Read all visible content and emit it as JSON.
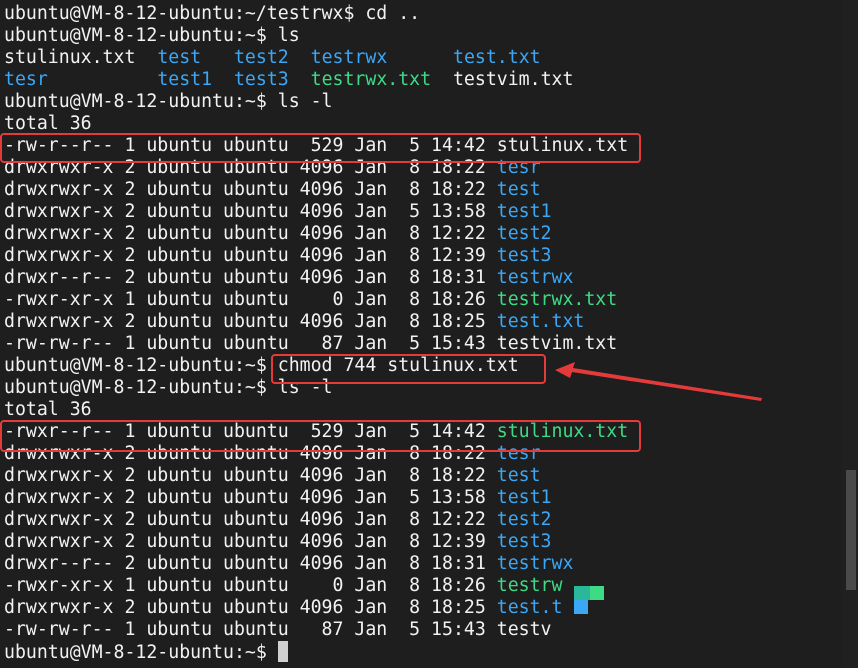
{
  "terminal": {
    "lines": [
      [
        {
          "t": "ubuntu@VM-8-12-ubuntu:~/testrwx$ cd ..",
          "c": "white"
        }
      ],
      [
        {
          "t": "ubuntu@VM-8-12-ubuntu:~$ ls",
          "c": "white"
        }
      ],
      [
        {
          "t": "stulinux.txt  ",
          "c": "white"
        },
        {
          "t": "test",
          "c": "blue"
        },
        {
          "t": "   ",
          "c": "white"
        },
        {
          "t": "test2",
          "c": "blue"
        },
        {
          "t": "  ",
          "c": "white"
        },
        {
          "t": "testrwx",
          "c": "blue"
        },
        {
          "t": "      ",
          "c": "white"
        },
        {
          "t": "test.txt",
          "c": "blue"
        }
      ],
      [
        {
          "t": "tesr",
          "c": "blue"
        },
        {
          "t": "          ",
          "c": "white"
        },
        {
          "t": "test1",
          "c": "blue"
        },
        {
          "t": "  ",
          "c": "white"
        },
        {
          "t": "test3",
          "c": "blue"
        },
        {
          "t": "  ",
          "c": "white"
        },
        {
          "t": "testrwx.txt",
          "c": "green"
        },
        {
          "t": "  testvim.txt",
          "c": "white"
        }
      ],
      [
        {
          "t": "ubuntu@VM-8-12-ubuntu:~$ ls -l",
          "c": "white"
        }
      ],
      [
        {
          "t": "total 36",
          "c": "white"
        }
      ],
      [
        {
          "t": "-rw-r--r-- 1 ubuntu ubuntu  529 Jan  5 14:42 stulinux.txt",
          "c": "white"
        }
      ],
      [
        {
          "t": "drwxrwxr-x 2 ubuntu ubuntu 4096 Jan  8 18:22 ",
          "c": "white"
        },
        {
          "t": "tesr",
          "c": "blue"
        }
      ],
      [
        {
          "t": "drwxrwxr-x 2 ubuntu ubuntu 4096 Jan  8 18:22 ",
          "c": "white"
        },
        {
          "t": "test",
          "c": "blue"
        }
      ],
      [
        {
          "t": "drwxrwxr-x 2 ubuntu ubuntu 4096 Jan  5 13:58 ",
          "c": "white"
        },
        {
          "t": "test1",
          "c": "blue"
        }
      ],
      [
        {
          "t": "drwxrwxr-x 2 ubuntu ubuntu 4096 Jan  8 12:22 ",
          "c": "white"
        },
        {
          "t": "test2",
          "c": "blue"
        }
      ],
      [
        {
          "t": "drwxrwxr-x 2 ubuntu ubuntu 4096 Jan  8 12:39 ",
          "c": "white"
        },
        {
          "t": "test3",
          "c": "blue"
        }
      ],
      [
        {
          "t": "drwxr--r-- 2 ubuntu ubuntu 4096 Jan  8 18:31 ",
          "c": "white"
        },
        {
          "t": "testrwx",
          "c": "blue"
        }
      ],
      [
        {
          "t": "-rwxr-xr-x 1 ubuntu ubuntu    0 Jan  8 18:26 ",
          "c": "white"
        },
        {
          "t": "testrwx.txt",
          "c": "green"
        }
      ],
      [
        {
          "t": "drwxrwxr-x 2 ubuntu ubuntu 4096 Jan  8 18:25 ",
          "c": "white"
        },
        {
          "t": "test.txt",
          "c": "blue"
        }
      ],
      [
        {
          "t": "-rw-rw-r-- 1 ubuntu ubuntu   87 Jan  5 15:43 testvim.txt",
          "c": "white"
        }
      ],
      [
        {
          "t": "ubuntu@VM-8-12-ubuntu:~$ chmod 744 stulinux.txt",
          "c": "white"
        }
      ],
      [
        {
          "t": "ubuntu@VM-8-12-ubuntu:~$ ls -l",
          "c": "white"
        }
      ],
      [
        {
          "t": "total 36",
          "c": "white"
        }
      ],
      [
        {
          "t": "-rwxr--r-- 1 ubuntu ubuntu  529 Jan  5 14:42 ",
          "c": "white"
        },
        {
          "t": "stulinux.txt",
          "c": "green"
        }
      ],
      [
        {
          "t": "drwxrwxr-x 2 ubuntu ubuntu 4096 Jan  8 18:22 ",
          "c": "white"
        },
        {
          "t": "tesr",
          "c": "blue"
        }
      ],
      [
        {
          "t": "drwxrwxr-x 2 ubuntu ubuntu 4096 Jan  8 18:22 ",
          "c": "white"
        },
        {
          "t": "test",
          "c": "blue"
        }
      ],
      [
        {
          "t": "drwxrwxr-x 2 ubuntu ubuntu 4096 Jan  5 13:58 ",
          "c": "white"
        },
        {
          "t": "test1",
          "c": "blue"
        }
      ],
      [
        {
          "t": "drwxrwxr-x 2 ubuntu ubuntu 4096 Jan  8 12:22 ",
          "c": "white"
        },
        {
          "t": "test2",
          "c": "blue"
        }
      ],
      [
        {
          "t": "drwxrwxr-x 2 ubuntu ubuntu 4096 Jan  8 12:39 ",
          "c": "white"
        },
        {
          "t": "test3",
          "c": "blue"
        }
      ],
      [
        {
          "t": "drwxr--r-- 2 ubuntu ubuntu 4096 Jan  8 18:31 ",
          "c": "white"
        },
        {
          "t": "testrwx",
          "c": "blue"
        }
      ],
      [
        {
          "t": "-rwxr-xr-x 1 ubuntu ubuntu    0 Jan  8 18:26 ",
          "c": "white"
        },
        {
          "t": "testrw",
          "c": "green"
        }
      ],
      [
        {
          "t": "drwxrwxr-x 2 ubuntu ubuntu 4096 Jan  8 18:25 ",
          "c": "white"
        },
        {
          "t": "test.t",
          "c": "blue"
        }
      ],
      [
        {
          "t": "-rw-rw-r-- 1 ubuntu ubuntu   87 Jan  5 15:43 testv",
          "c": "white"
        }
      ],
      [
        {
          "t": "ubuntu@VM-8-12-ubuntu:~$ ",
          "c": "white"
        }
      ]
    ]
  },
  "colors": {
    "background": "#1e1e1e",
    "text": "#f2f2f2",
    "directory": "#3ba7f5",
    "executable": "#3ddc84",
    "annotation": "#e53a3a"
  }
}
